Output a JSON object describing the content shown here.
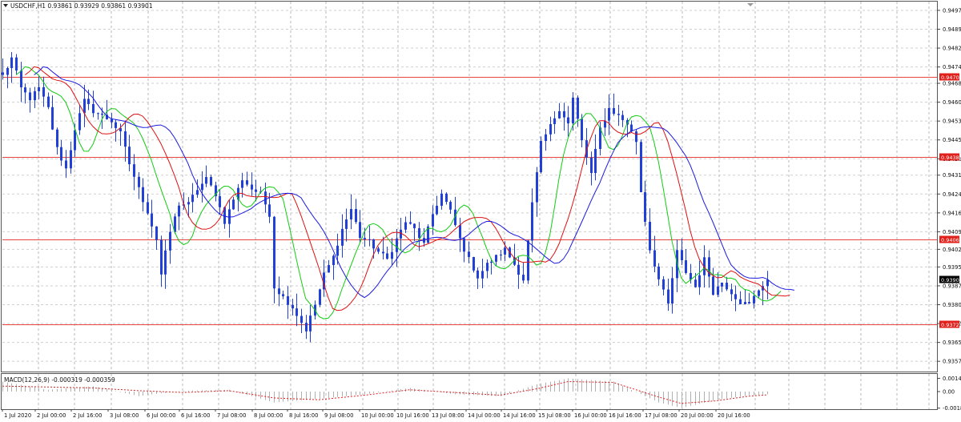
{
  "header": {
    "symbol_line": "USDCHF,H1  0.93861 0.93929 0.93861 0.93901"
  },
  "macd": {
    "label": "MACD(12,26,9) -0.000319 -0.000359",
    "ticks": [
      "0.001458",
      "0.00",
      "-0.00182"
    ]
  },
  "colors": {
    "candle": "#2040d8",
    "ma_fast": "#11cc11",
    "ma_mid": "#dd1111",
    "ma_slow": "#1a1ae0",
    "hline": "#e8453c",
    "grid": "#b8b8b8",
    "signal": "#dd2222",
    "histogram": "#b0b0b0"
  },
  "chart_data": {
    "type": "candlestick",
    "ylim": [
      0.936,
      0.9497
    ],
    "y_ticks": [
      "0.94970",
      "0.94895",
      "0.94820",
      "0.94745",
      "0.94680",
      "0.94605",
      "0.94530",
      "0.94455",
      "0.94380",
      "0.94315",
      "0.94240",
      "0.94165",
      "0.94090",
      "0.94020",
      "0.93950",
      "0.93875",
      "0.93800",
      "0.93725",
      "0.93650",
      "0.93575"
    ],
    "x_labels": [
      "1 Jul 2020",
      "2 Jul 00:00",
      "2 Jul 16:00",
      "3 Jul 08:00",
      "6 Jul 00:00",
      "6 Jul 16:00",
      "7 Jul 08:00",
      "8 Jul 00:00",
      "8 Jul 16:00",
      "9 Jul 08:00",
      "10 Jul 00:00",
      "10 Jul 16:00",
      "13 Jul 08:00",
      "14 Jul 00:00",
      "14 Jul 16:00",
      "15 Jul 08:00",
      "16 Jul 00:00",
      "16 Jul 16:00",
      "17 Jul 08:00",
      "20 Jul 00:00",
      "20 Jul 16:00"
    ],
    "horizontal_levels": [
      {
        "value": 0.94706,
        "label": "0.94706"
      },
      {
        "value": 0.94388,
        "label": "0.94388"
      },
      {
        "value": 0.9406,
        "label": "0.94060"
      },
      {
        "value": 0.93722,
        "label": "0.93722"
      }
    ],
    "current_price": {
      "value": 0.93901,
      "label": "0.93901"
    },
    "close_path": [
      [
        0,
        0.9471
      ],
      [
        2,
        0.9478
      ],
      [
        4,
        0.9466
      ],
      [
        6,
        0.9462
      ],
      [
        8,
        0.9466
      ],
      [
        10,
        0.9458
      ],
      [
        12,
        0.9442
      ],
      [
        14,
        0.9434
      ],
      [
        16,
        0.945
      ],
      [
        18,
        0.9461
      ],
      [
        20,
        0.9457
      ],
      [
        22,
        0.9455
      ],
      [
        24,
        0.9453
      ],
      [
        26,
        0.9448
      ],
      [
        28,
        0.9436
      ],
      [
        30,
        0.9426
      ],
      [
        32,
        0.9417
      ],
      [
        34,
        0.9406
      ],
      [
        35,
        0.9392
      ],
      [
        37,
        0.9409
      ],
      [
        39,
        0.942
      ],
      [
        41,
        0.942
      ],
      [
        43,
        0.9426
      ],
      [
        45,
        0.943
      ],
      [
        47,
        0.9424
      ],
      [
        49,
        0.9413
      ],
      [
        51,
        0.9422
      ],
      [
        53,
        0.943
      ],
      [
        55,
        0.9426
      ],
      [
        57,
        0.9424
      ],
      [
        59,
        0.9416
      ],
      [
        60,
        0.9387
      ],
      [
        62,
        0.9383
      ],
      [
        64,
        0.9379
      ],
      [
        66,
        0.9373
      ],
      [
        67,
        0.937
      ],
      [
        69,
        0.938
      ],
      [
        71,
        0.9392
      ],
      [
        73,
        0.9399
      ],
      [
        75,
        0.941
      ],
      [
        77,
        0.9418
      ],
      [
        79,
        0.9407
      ],
      [
        81,
        0.9405
      ],
      [
        83,
        0.9401
      ],
      [
        85,
        0.9398
      ],
      [
        87,
        0.9406
      ],
      [
        89,
        0.9413
      ],
      [
        91,
        0.941
      ],
      [
        93,
        0.9404
      ],
      [
        95,
        0.9416
      ],
      [
        97,
        0.9424
      ],
      [
        99,
        0.9417
      ],
      [
        101,
        0.9406
      ],
      [
        103,
        0.9398
      ],
      [
        105,
        0.9391
      ],
      [
        107,
        0.9396
      ],
      [
        109,
        0.9399
      ],
      [
        111,
        0.9402
      ],
      [
        113,
        0.9396
      ],
      [
        115,
        0.939
      ],
      [
        117,
        0.942
      ],
      [
        119,
        0.9444
      ],
      [
        121,
        0.9451
      ],
      [
        123,
        0.9458
      ],
      [
        125,
        0.9452
      ],
      [
        126,
        0.9462
      ],
      [
        128,
        0.9445
      ],
      [
        130,
        0.9432
      ],
      [
        132,
        0.945
      ],
      [
        134,
        0.9458
      ],
      [
        136,
        0.9455
      ],
      [
        138,
        0.9452
      ],
      [
        140,
        0.9445
      ],
      [
        141,
        0.9425
      ],
      [
        143,
        0.9402
      ],
      [
        145,
        0.939
      ],
      [
        147,
        0.938
      ],
      [
        149,
        0.9401
      ],
      [
        151,
        0.9393
      ],
      [
        153,
        0.9387
      ],
      [
        155,
        0.9398
      ],
      [
        157,
        0.9385
      ],
      [
        159,
        0.9389
      ],
      [
        161,
        0.9385
      ],
      [
        163,
        0.9381
      ],
      [
        165,
        0.938
      ],
      [
        167,
        0.9386
      ],
      [
        169,
        0.939
      ]
    ],
    "macd_histogram_path": [
      [
        0,
        0.0011
      ],
      [
        10,
        0.0002
      ],
      [
        20,
        0.0006
      ],
      [
        30,
        -0.0005
      ],
      [
        40,
        0.0001
      ],
      [
        50,
        0.0002
      ],
      [
        60,
        -0.0012
      ],
      [
        70,
        -0.0008
      ],
      [
        80,
        -0.0003
      ],
      [
        90,
        0.0004
      ],
      [
        100,
        -0.0003
      ],
      [
        110,
        -0.0005
      ],
      [
        118,
        0.0008
      ],
      [
        125,
        0.00145
      ],
      [
        135,
        0.0011
      ],
      [
        145,
        -0.0012
      ],
      [
        150,
        -0.0018
      ],
      [
        158,
        -0.0009
      ],
      [
        165,
        -0.0004
      ],
      [
        169,
        -0.0003
      ]
    ],
    "macd_signal_path": [
      [
        0,
        0.0006
      ],
      [
        10,
        0.0005
      ],
      [
        20,
        0.0004
      ],
      [
        30,
        0.0001
      ],
      [
        40,
        -0.0001
      ],
      [
        50,
        0.0001
      ],
      [
        60,
        -0.0007
      ],
      [
        70,
        -0.0009
      ],
      [
        80,
        -0.0004
      ],
      [
        90,
        0.0002
      ],
      [
        100,
        -0.0001
      ],
      [
        110,
        -0.0004
      ],
      [
        118,
        0.0003
      ],
      [
        125,
        0.0011
      ],
      [
        135,
        0.001
      ],
      [
        145,
        -0.0006
      ],
      [
        150,
        -0.0013
      ],
      [
        158,
        -0.001
      ],
      [
        165,
        -0.0005
      ],
      [
        169,
        -0.00036
      ]
    ]
  }
}
